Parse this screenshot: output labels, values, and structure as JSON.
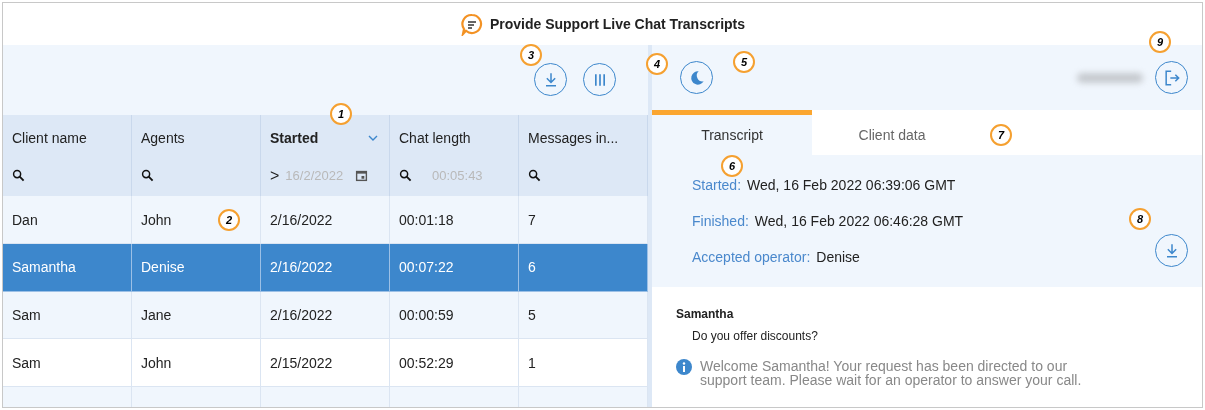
{
  "window": {
    "title": "Provide Support Live Chat Transcripts"
  },
  "toolbar": {
    "download_callout": "3",
    "columns_callout": "4"
  },
  "table": {
    "columns": [
      {
        "label": "Client name",
        "sorted": false,
        "filter": {
          "kind": "search"
        }
      },
      {
        "label": "Agents",
        "sorted": false,
        "filter": {
          "kind": "search"
        }
      },
      {
        "label": "Started",
        "sorted": true,
        "callout": "1",
        "filter": {
          "kind": "date",
          "operator": ">",
          "placeholder": "16/2/2022"
        }
      },
      {
        "label": "Chat length",
        "sorted": false,
        "filter": {
          "kind": "search",
          "placeholder": "00:05:43"
        }
      },
      {
        "label": "Messages in...",
        "sorted": false,
        "filter": {
          "kind": "search"
        }
      }
    ],
    "rows": [
      {
        "cells": [
          "Dan",
          "John",
          "2/16/2022",
          "00:01:18",
          "7"
        ],
        "selected": false,
        "callout": "2"
      },
      {
        "cells": [
          "Samantha",
          "Denise",
          "2/16/2022",
          "00:07:22",
          "6"
        ],
        "selected": true
      },
      {
        "cells": [
          "Sam",
          "Jane",
          "2/16/2022",
          "00:00:59",
          "5"
        ],
        "selected": false
      },
      {
        "cells": [
          "Sam",
          "John",
          "2/15/2022",
          "00:52:29",
          "1"
        ],
        "selected": false
      }
    ]
  },
  "detail": {
    "theme_callout": "5",
    "logout_callout": "9",
    "tabs": [
      {
        "label": "Transcript",
        "selected": true,
        "callout": "6"
      },
      {
        "label": "Client data",
        "selected": false,
        "callout": "7"
      }
    ],
    "fields": [
      {
        "label": "Started:",
        "value": "Wed, 16 Feb 2022 06:39:06 GMT"
      },
      {
        "label": "Finished:",
        "value": "Wed, 16 Feb 2022 06:46:28 GMT"
      },
      {
        "label": "Accepted operator:",
        "value": "Denise"
      }
    ],
    "download_callout": "8",
    "messages": [
      {
        "kind": "client",
        "author": "Samantha",
        "text": "Do you offer discounts?"
      },
      {
        "kind": "system",
        "text": "Welcome Samantha! Your request has been directed to our support team. Please wait for an operator to answer your call."
      }
    ]
  }
}
